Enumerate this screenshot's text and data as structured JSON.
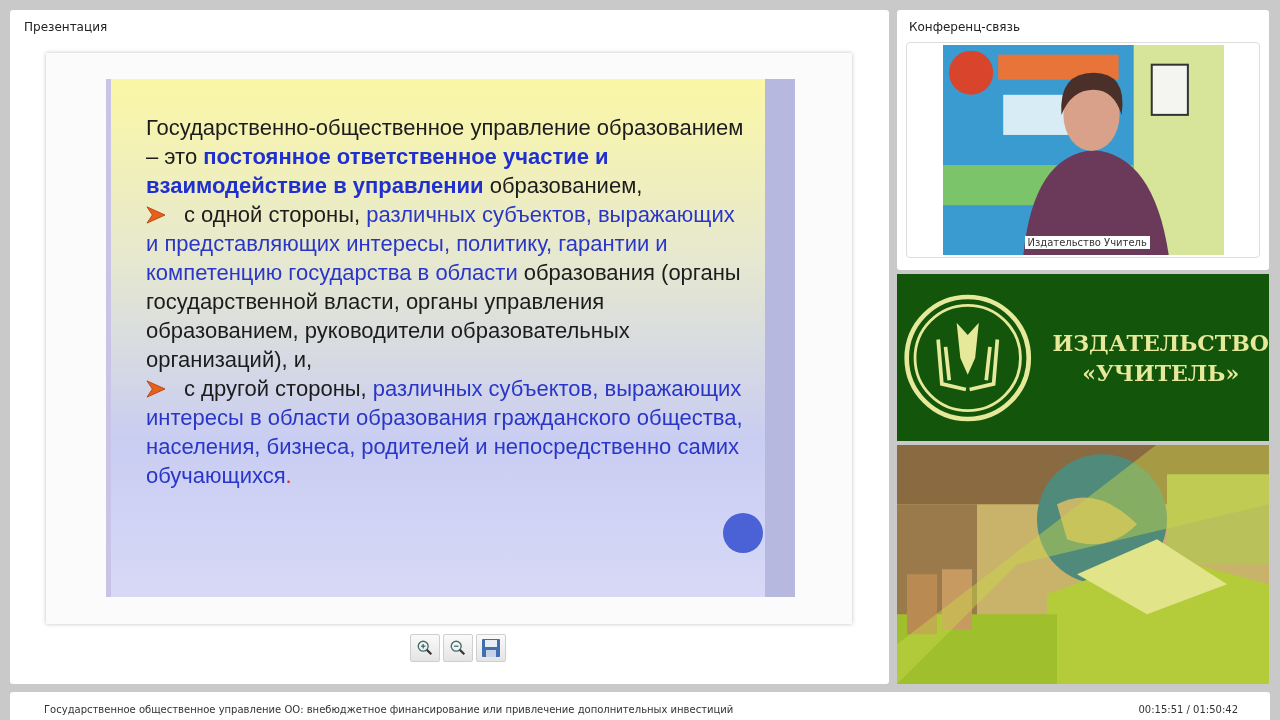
{
  "presentation": {
    "title": "Презентация",
    "slide": {
      "paragraphs": [
        {
          "kind": "plain",
          "segments": [
            {
              "kind": "plain",
              "text": "Государственно-общественное управление образованием – это "
            },
            {
              "kind": "strong",
              "text": "постоянное ответственное участие и взаимодействие в управлении"
            },
            {
              "kind": "plain",
              "text": " образованием,"
            }
          ]
        },
        {
          "kind": "bullet",
          "segments": [
            {
              "kind": "plain",
              "text": "с одной стороны, "
            },
            {
              "kind": "accent",
              "text": "различных субъектов, выражающих и представляющих интересы, политику, гарантии и компетенцию государства в области"
            },
            {
              "kind": "plain",
              "text": " образования (органы государственной власти, органы управления образованием, руководители образовательных организаций), и,"
            }
          ]
        },
        {
          "kind": "bullet",
          "segments": [
            {
              "kind": "plain",
              "text": "с другой стороны, "
            },
            {
              "kind": "accent",
              "text": "различных субъектов, выражающих интересы в области образования гражданского общества, населения, бизнеса, родителей и непосредственно самих обучающихся"
            },
            {
              "kind": "alert",
              "text": "."
            }
          ]
        }
      ]
    },
    "toolbar": [
      {
        "kind": "zoom-in"
      },
      {
        "kind": "zoom-out"
      },
      {
        "kind": "save"
      }
    ]
  },
  "conference": {
    "title": "Конференц-связь",
    "caption": "Издательство Учитель"
  },
  "banner": {
    "title_line_1": "ИЗДАТЕЛЬСТВО",
    "title_line_2": "«УЧИТЕЛЬ»"
  },
  "status_bar": {
    "event_title": "Государственное общественное управление ОО: внебюджетное финансирование или привлечение дополнительных инвестиций",
    "time": "00:15:51 / 01:50:42"
  }
}
